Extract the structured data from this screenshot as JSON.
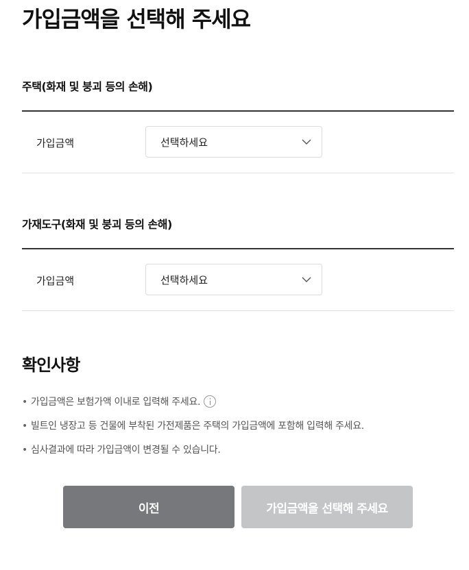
{
  "page": {
    "title": "가입금액을 선택해 주세요"
  },
  "sections": [
    {
      "title": "주택(화재 및 붕괴 등의 손해)",
      "field_label": "가입금액",
      "select_value": "선택하세요"
    },
    {
      "title": "가재도구(화재 및 붕괴 등의 손해)",
      "field_label": "가입금액",
      "select_value": "선택하세요"
    }
  ],
  "confirm": {
    "title": "확인사항",
    "bullet": "•",
    "notes": [
      "가입금액은 보험가액 이내로 입력해 주세요.",
      "빌트인 냉장고 등 건물에 부착된 가전제품은 주택의 가입금액에 포함해 입력해 주세요.",
      "심사결과에 따라 가입금액이 변경될 수 있습니다."
    ]
  },
  "buttons": {
    "prev_label": "이전",
    "next_label": "가입금액을 선택해 주세요"
  },
  "icons": {
    "select_chevron": "chevron-down-icon",
    "info": "info-icon"
  },
  "colors": {
    "prev_button": "#76787c",
    "next_button_disabled": "#c4c5c7",
    "divider": "#333333"
  }
}
